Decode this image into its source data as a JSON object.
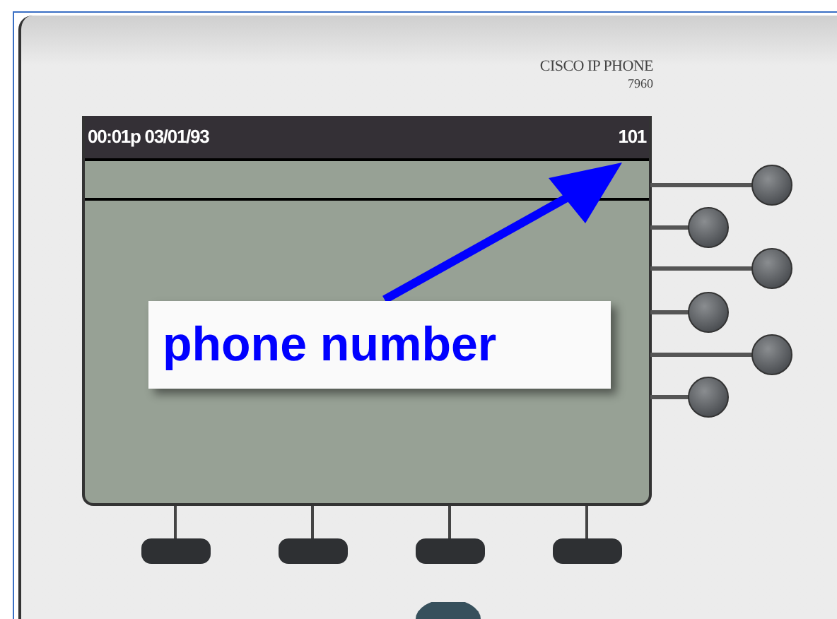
{
  "phone": {
    "brand": "CISCO IP PHONE",
    "model": "7960"
  },
  "screen": {
    "datetime": "00:01p 03/01/93",
    "extension": "101"
  },
  "annotation": {
    "label": "phone number"
  }
}
